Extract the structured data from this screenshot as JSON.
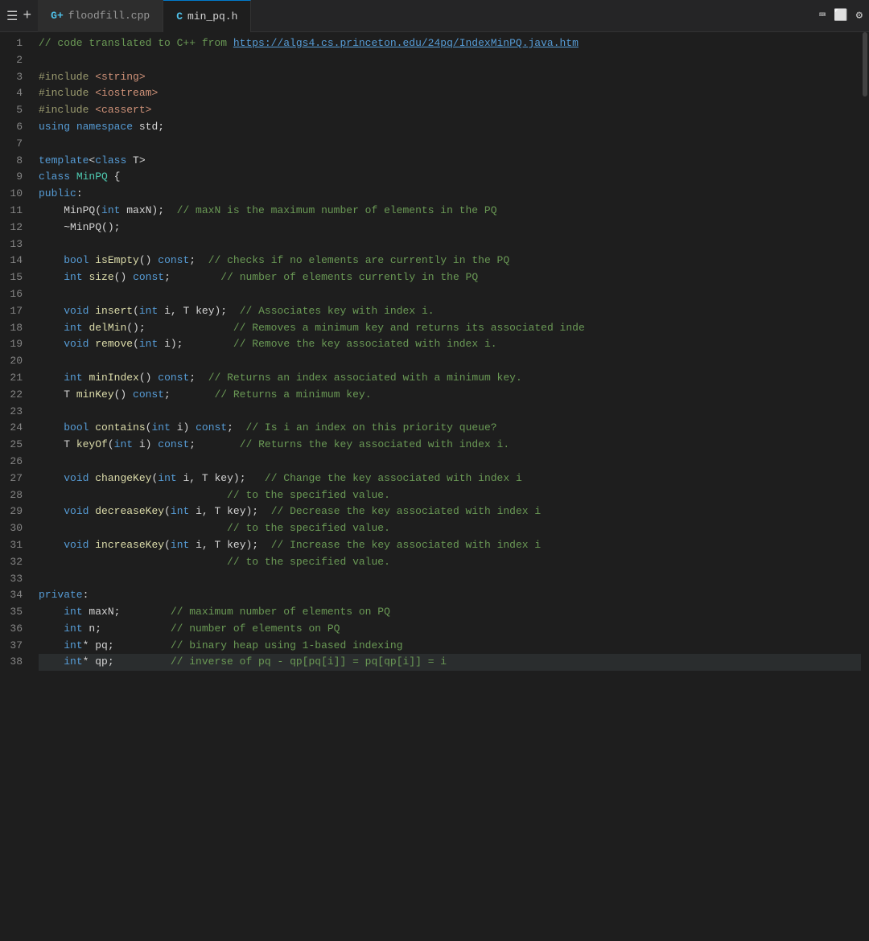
{
  "titleBar": {
    "menuIcon": "☰",
    "addIcon": "+",
    "tabs": [
      {
        "id": "tab-floodfill",
        "icon": "G+",
        "label": "floodfill.cpp",
        "active": false
      },
      {
        "id": "tab-minpq",
        "icon": "C",
        "label": "min_pq.h",
        "active": true
      }
    ],
    "rightButtons": [
      "terminal-icon",
      "maximize-icon",
      "settings-icon"
    ]
  },
  "editor": {
    "lines": [
      {
        "num": 1,
        "tokens": [
          {
            "cls": "cmt",
            "text": "// code translated to C++ from "
          },
          {
            "cls": "link",
            "text": "https://algs4.cs.princeton.edu/24pq/IndexMinPQ.java.htm"
          }
        ]
      },
      {
        "num": 2,
        "tokens": []
      },
      {
        "num": 3,
        "tokens": [
          {
            "cls": "pp",
            "text": "#include"
          },
          {
            "cls": "plain",
            "text": " "
          },
          {
            "cls": "incl",
            "text": "<string>"
          }
        ]
      },
      {
        "num": 4,
        "tokens": [
          {
            "cls": "pp",
            "text": "#include"
          },
          {
            "cls": "plain",
            "text": " "
          },
          {
            "cls": "incl",
            "text": "<iostream>"
          }
        ]
      },
      {
        "num": 5,
        "tokens": [
          {
            "cls": "pp",
            "text": "#include"
          },
          {
            "cls": "plain",
            "text": " "
          },
          {
            "cls": "incl",
            "text": "<cassert>"
          }
        ]
      },
      {
        "num": 6,
        "tokens": [
          {
            "cls": "kw",
            "text": "using"
          },
          {
            "cls": "plain",
            "text": " "
          },
          {
            "cls": "kw",
            "text": "namespace"
          },
          {
            "cls": "plain",
            "text": " std;"
          }
        ]
      },
      {
        "num": 7,
        "tokens": []
      },
      {
        "num": 8,
        "tokens": [
          {
            "cls": "kw",
            "text": "template"
          },
          {
            "cls": "plain",
            "text": "<"
          },
          {
            "cls": "kw",
            "text": "class"
          },
          {
            "cls": "plain",
            "text": " T>"
          }
        ]
      },
      {
        "num": 9,
        "tokens": [
          {
            "cls": "kw",
            "text": "class"
          },
          {
            "cls": "plain",
            "text": " "
          },
          {
            "cls": "type",
            "text": "MinPQ"
          },
          {
            "cls": "plain",
            "text": " {"
          }
        ]
      },
      {
        "num": 10,
        "tokens": [
          {
            "cls": "kw",
            "text": "public"
          },
          {
            "cls": "plain",
            "text": ":"
          }
        ]
      },
      {
        "num": 11,
        "tokens": [
          {
            "cls": "plain",
            "text": "    MinPQ("
          },
          {
            "cls": "kw",
            "text": "int"
          },
          {
            "cls": "plain",
            "text": " maxN);  "
          },
          {
            "cls": "cmt",
            "text": "// maxN is the maximum number of elements in the PQ"
          }
        ]
      },
      {
        "num": 12,
        "tokens": [
          {
            "cls": "plain",
            "text": "    ~MinPQ();"
          }
        ]
      },
      {
        "num": 13,
        "tokens": []
      },
      {
        "num": 14,
        "tokens": [
          {
            "cls": "plain",
            "text": "    "
          },
          {
            "cls": "kw",
            "text": "bool"
          },
          {
            "cls": "plain",
            "text": " "
          },
          {
            "cls": "fn",
            "text": "isEmpty"
          },
          {
            "cls": "plain",
            "text": "() "
          },
          {
            "cls": "kw",
            "text": "const"
          },
          {
            "cls": "plain",
            "text": ";  "
          },
          {
            "cls": "cmt",
            "text": "// checks if no elements are currently in the PQ"
          }
        ]
      },
      {
        "num": 15,
        "tokens": [
          {
            "cls": "plain",
            "text": "    "
          },
          {
            "cls": "kw",
            "text": "int"
          },
          {
            "cls": "plain",
            "text": " "
          },
          {
            "cls": "fn",
            "text": "size"
          },
          {
            "cls": "plain",
            "text": "() "
          },
          {
            "cls": "kw",
            "text": "const"
          },
          {
            "cls": "plain",
            "text": ";        "
          },
          {
            "cls": "cmt",
            "text": "// number of elements currently in the PQ"
          }
        ]
      },
      {
        "num": 16,
        "tokens": []
      },
      {
        "num": 17,
        "tokens": [
          {
            "cls": "plain",
            "text": "    "
          },
          {
            "cls": "kw",
            "text": "void"
          },
          {
            "cls": "plain",
            "text": " "
          },
          {
            "cls": "fn",
            "text": "insert"
          },
          {
            "cls": "plain",
            "text": "("
          },
          {
            "cls": "kw",
            "text": "int"
          },
          {
            "cls": "plain",
            "text": " i, T key);  "
          },
          {
            "cls": "cmt",
            "text": "// Associates key with index i."
          }
        ]
      },
      {
        "num": 18,
        "tokens": [
          {
            "cls": "plain",
            "text": "    "
          },
          {
            "cls": "kw",
            "text": "int"
          },
          {
            "cls": "plain",
            "text": " "
          },
          {
            "cls": "fn",
            "text": "delMin"
          },
          {
            "cls": "plain",
            "text": "();              "
          },
          {
            "cls": "cmt",
            "text": "// Removes a minimum key and returns its associated inde"
          }
        ]
      },
      {
        "num": 19,
        "tokens": [
          {
            "cls": "plain",
            "text": "    "
          },
          {
            "cls": "kw",
            "text": "void"
          },
          {
            "cls": "plain",
            "text": " "
          },
          {
            "cls": "fn",
            "text": "remove"
          },
          {
            "cls": "plain",
            "text": "("
          },
          {
            "cls": "kw",
            "text": "int"
          },
          {
            "cls": "plain",
            "text": " i);        "
          },
          {
            "cls": "cmt",
            "text": "// Remove the key associated with index i."
          }
        ]
      },
      {
        "num": 20,
        "tokens": []
      },
      {
        "num": 21,
        "tokens": [
          {
            "cls": "plain",
            "text": "    "
          },
          {
            "cls": "kw",
            "text": "int"
          },
          {
            "cls": "plain",
            "text": " "
          },
          {
            "cls": "fn",
            "text": "minIndex"
          },
          {
            "cls": "plain",
            "text": "() "
          },
          {
            "cls": "kw",
            "text": "const"
          },
          {
            "cls": "plain",
            "text": ";  "
          },
          {
            "cls": "cmt",
            "text": "// Returns an index associated with a minimum key."
          }
        ]
      },
      {
        "num": 22,
        "tokens": [
          {
            "cls": "plain",
            "text": "    T "
          },
          {
            "cls": "fn",
            "text": "minKey"
          },
          {
            "cls": "plain",
            "text": "() "
          },
          {
            "cls": "kw",
            "text": "const"
          },
          {
            "cls": "plain",
            "text": ";       "
          },
          {
            "cls": "cmt",
            "text": "// Returns a minimum key."
          }
        ]
      },
      {
        "num": 23,
        "tokens": []
      },
      {
        "num": 24,
        "tokens": [
          {
            "cls": "plain",
            "text": "    "
          },
          {
            "cls": "kw",
            "text": "bool"
          },
          {
            "cls": "plain",
            "text": " "
          },
          {
            "cls": "fn",
            "text": "contains"
          },
          {
            "cls": "plain",
            "text": "("
          },
          {
            "cls": "kw",
            "text": "int"
          },
          {
            "cls": "plain",
            "text": " i) "
          },
          {
            "cls": "kw",
            "text": "const"
          },
          {
            "cls": "plain",
            "text": ";  "
          },
          {
            "cls": "cmt",
            "text": "// Is i an index on this priority queue?"
          }
        ]
      },
      {
        "num": 25,
        "tokens": [
          {
            "cls": "plain",
            "text": "    T "
          },
          {
            "cls": "fn",
            "text": "keyOf"
          },
          {
            "cls": "plain",
            "text": "("
          },
          {
            "cls": "kw",
            "text": "int"
          },
          {
            "cls": "plain",
            "text": " i) "
          },
          {
            "cls": "kw",
            "text": "const"
          },
          {
            "cls": "plain",
            "text": ";       "
          },
          {
            "cls": "cmt",
            "text": "// Returns the key associated with index i."
          }
        ]
      },
      {
        "num": 26,
        "tokens": []
      },
      {
        "num": 27,
        "tokens": [
          {
            "cls": "plain",
            "text": "    "
          },
          {
            "cls": "kw",
            "text": "void"
          },
          {
            "cls": "plain",
            "text": " "
          },
          {
            "cls": "fn",
            "text": "changeKey"
          },
          {
            "cls": "plain",
            "text": "("
          },
          {
            "cls": "kw",
            "text": "int"
          },
          {
            "cls": "plain",
            "text": " i, T key);   "
          },
          {
            "cls": "cmt",
            "text": "// Change the key associated with index i"
          }
        ]
      },
      {
        "num": 28,
        "tokens": [
          {
            "cls": "plain",
            "text": "                              "
          },
          {
            "cls": "cmt",
            "text": "// to the specified value."
          }
        ]
      },
      {
        "num": 29,
        "tokens": [
          {
            "cls": "plain",
            "text": "    "
          },
          {
            "cls": "kw",
            "text": "void"
          },
          {
            "cls": "plain",
            "text": " "
          },
          {
            "cls": "fn",
            "text": "decreaseKey"
          },
          {
            "cls": "plain",
            "text": "("
          },
          {
            "cls": "kw",
            "text": "int"
          },
          {
            "cls": "plain",
            "text": " i, T key);  "
          },
          {
            "cls": "cmt",
            "text": "// Decrease the key associated with index i"
          }
        ]
      },
      {
        "num": 30,
        "tokens": [
          {
            "cls": "plain",
            "text": "                              "
          },
          {
            "cls": "cmt",
            "text": "// to the specified value."
          }
        ]
      },
      {
        "num": 31,
        "tokens": [
          {
            "cls": "plain",
            "text": "    "
          },
          {
            "cls": "kw",
            "text": "void"
          },
          {
            "cls": "plain",
            "text": " "
          },
          {
            "cls": "fn",
            "text": "increaseKey"
          },
          {
            "cls": "plain",
            "text": "("
          },
          {
            "cls": "kw",
            "text": "int"
          },
          {
            "cls": "plain",
            "text": " i, T key);  "
          },
          {
            "cls": "cmt",
            "text": "// Increase the key associated with index i"
          }
        ]
      },
      {
        "num": 32,
        "tokens": [
          {
            "cls": "plain",
            "text": "                              "
          },
          {
            "cls": "cmt",
            "text": "// to the specified value."
          }
        ]
      },
      {
        "num": 33,
        "tokens": []
      },
      {
        "num": 34,
        "tokens": [
          {
            "cls": "kw",
            "text": "private"
          },
          {
            "cls": "plain",
            "text": ":"
          }
        ]
      },
      {
        "num": 35,
        "tokens": [
          {
            "cls": "plain",
            "text": "    "
          },
          {
            "cls": "kw",
            "text": "int"
          },
          {
            "cls": "plain",
            "text": " maxN;        "
          },
          {
            "cls": "cmt",
            "text": "// maximum number of elements on PQ"
          }
        ]
      },
      {
        "num": 36,
        "tokens": [
          {
            "cls": "plain",
            "text": "    "
          },
          {
            "cls": "kw",
            "text": "int"
          },
          {
            "cls": "plain",
            "text": " n;           "
          },
          {
            "cls": "cmt",
            "text": "// number of elements on PQ"
          }
        ]
      },
      {
        "num": 37,
        "tokens": [
          {
            "cls": "plain",
            "text": "    "
          },
          {
            "cls": "kw",
            "text": "int"
          },
          {
            "cls": "plain",
            "text": "* pq;         "
          },
          {
            "cls": "cmt",
            "text": "// binary heap using 1-based indexing"
          }
        ]
      },
      {
        "num": 38,
        "tokens": [
          {
            "cls": "plain",
            "text": "    "
          },
          {
            "cls": "kw",
            "text": "int"
          },
          {
            "cls": "plain",
            "text": "* qp;         "
          },
          {
            "cls": "cmt",
            "text": "// inverse of pq - qp[pq[i]] = pq[qp[i]] = i"
          }
        ]
      }
    ]
  }
}
